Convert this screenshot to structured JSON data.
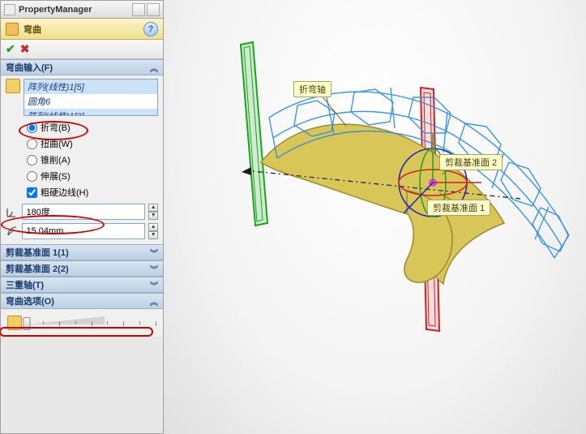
{
  "titlebar": {
    "title": "PropertyManager"
  },
  "feature": {
    "title": "弯曲"
  },
  "sections": {
    "input": {
      "header": "弯曲输入(F)",
      "list_items": [
        "阵列(线性)1[5]",
        "圆角6",
        "阵列(线性)1[2]"
      ],
      "radios": {
        "bend": {
          "label": "折弯(B)",
          "checked": true
        },
        "twist": {
          "label": "扭曲(W)",
          "checked": false
        },
        "taper": {
          "label": "锥削(A)",
          "checked": false
        },
        "stretch": {
          "label": "伸展(S)",
          "checked": false
        }
      },
      "hard_edges": {
        "label": "粗硬边线(H)",
        "checked": true
      },
      "angle": "180度",
      "radius": "15.04mm"
    },
    "trim1": {
      "header": "剪裁基准面 1(1)"
    },
    "trim2": {
      "header": "剪裁基准面 2(2)"
    },
    "triad": {
      "header": "三重轴(T)"
    },
    "options": {
      "header": "弯曲选项(O)"
    }
  },
  "viewport": {
    "labels": {
      "bend_axis": "折弯轴",
      "trim_plane_2": "剪裁基准面 2",
      "trim_plane_1": "剪裁基准面 1"
    }
  }
}
